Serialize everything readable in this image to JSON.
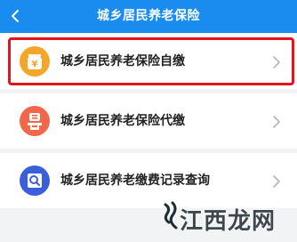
{
  "header": {
    "title": "城乡居民养老保险"
  },
  "menu": {
    "items": [
      {
        "label": "城乡居民养老保险自缴",
        "icon": "savings-jar-icon",
        "icon_color": "#f4a62a"
      },
      {
        "label": "城乡居民养老保险代缴",
        "icon": "hand-payment-icon",
        "icon_color": "#f0674a"
      },
      {
        "label": "城乡居民养老缴费记录查询",
        "icon": "search-record-icon",
        "icon_color": "#3b5fd8"
      }
    ]
  },
  "watermark": {
    "text": "江西龙网"
  },
  "colors": {
    "header": "#1a8cf0",
    "highlight": "#e4141f",
    "background": "#f2f3f5"
  }
}
